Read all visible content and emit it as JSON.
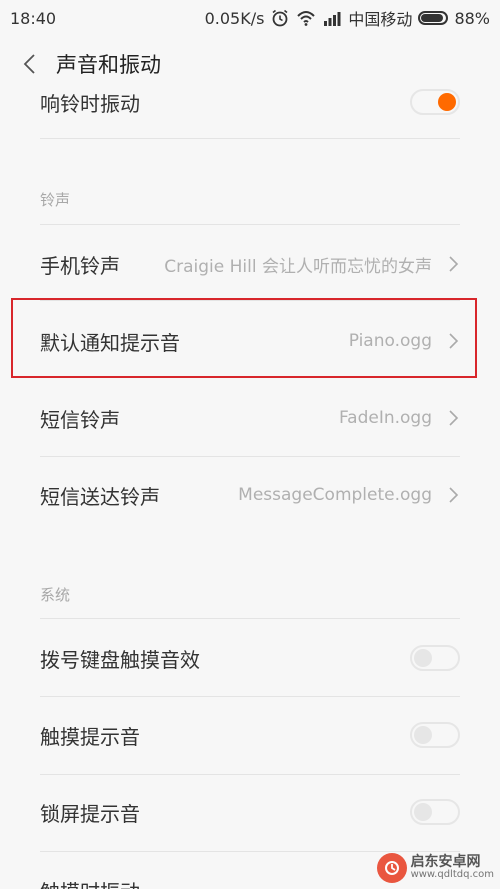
{
  "status_bar": {
    "time": "18:40",
    "speed": "0.05K/s",
    "carrier": "中国移动",
    "battery": "88%",
    "battery_level": 0.88,
    "icons": [
      "alarm-icon",
      "wifi-icon",
      "signal-icon",
      "battery-icon"
    ]
  },
  "header": {
    "title": "声音和振动",
    "back_icon": "chevron-left-icon"
  },
  "rows": {
    "ring_vibrate": {
      "label": "响铃时振动",
      "toggle_on": true
    },
    "ringtone_section": "铃声",
    "phone_ringtone": {
      "label": "手机铃声",
      "value": "Craigie Hill 会让人听而忘忧的女声"
    },
    "notification_sound": {
      "label": "默认通知提示音",
      "value": "Piano.ogg"
    },
    "sms_ringtone": {
      "label": "短信铃声",
      "value": "FadeIn.ogg"
    },
    "sms_delivered": {
      "label": "短信送达铃声",
      "value": "MessageComplete.ogg"
    },
    "system_section": "系统",
    "dialpad_sound": {
      "label": "拨号键盘触摸音效",
      "toggle_on": false
    },
    "touch_sound": {
      "label": "触摸提示音",
      "toggle_on": false
    },
    "lock_sound": {
      "label": "锁屏提示音",
      "toggle_on": false
    },
    "touch_vibrate": {
      "label": "触摸时振动"
    }
  },
  "colors": {
    "accent": "#ff6a00",
    "highlight_border": "#d8262b"
  },
  "watermark": {
    "title": "启东安卓网",
    "url": "www.qdltdq.com"
  }
}
